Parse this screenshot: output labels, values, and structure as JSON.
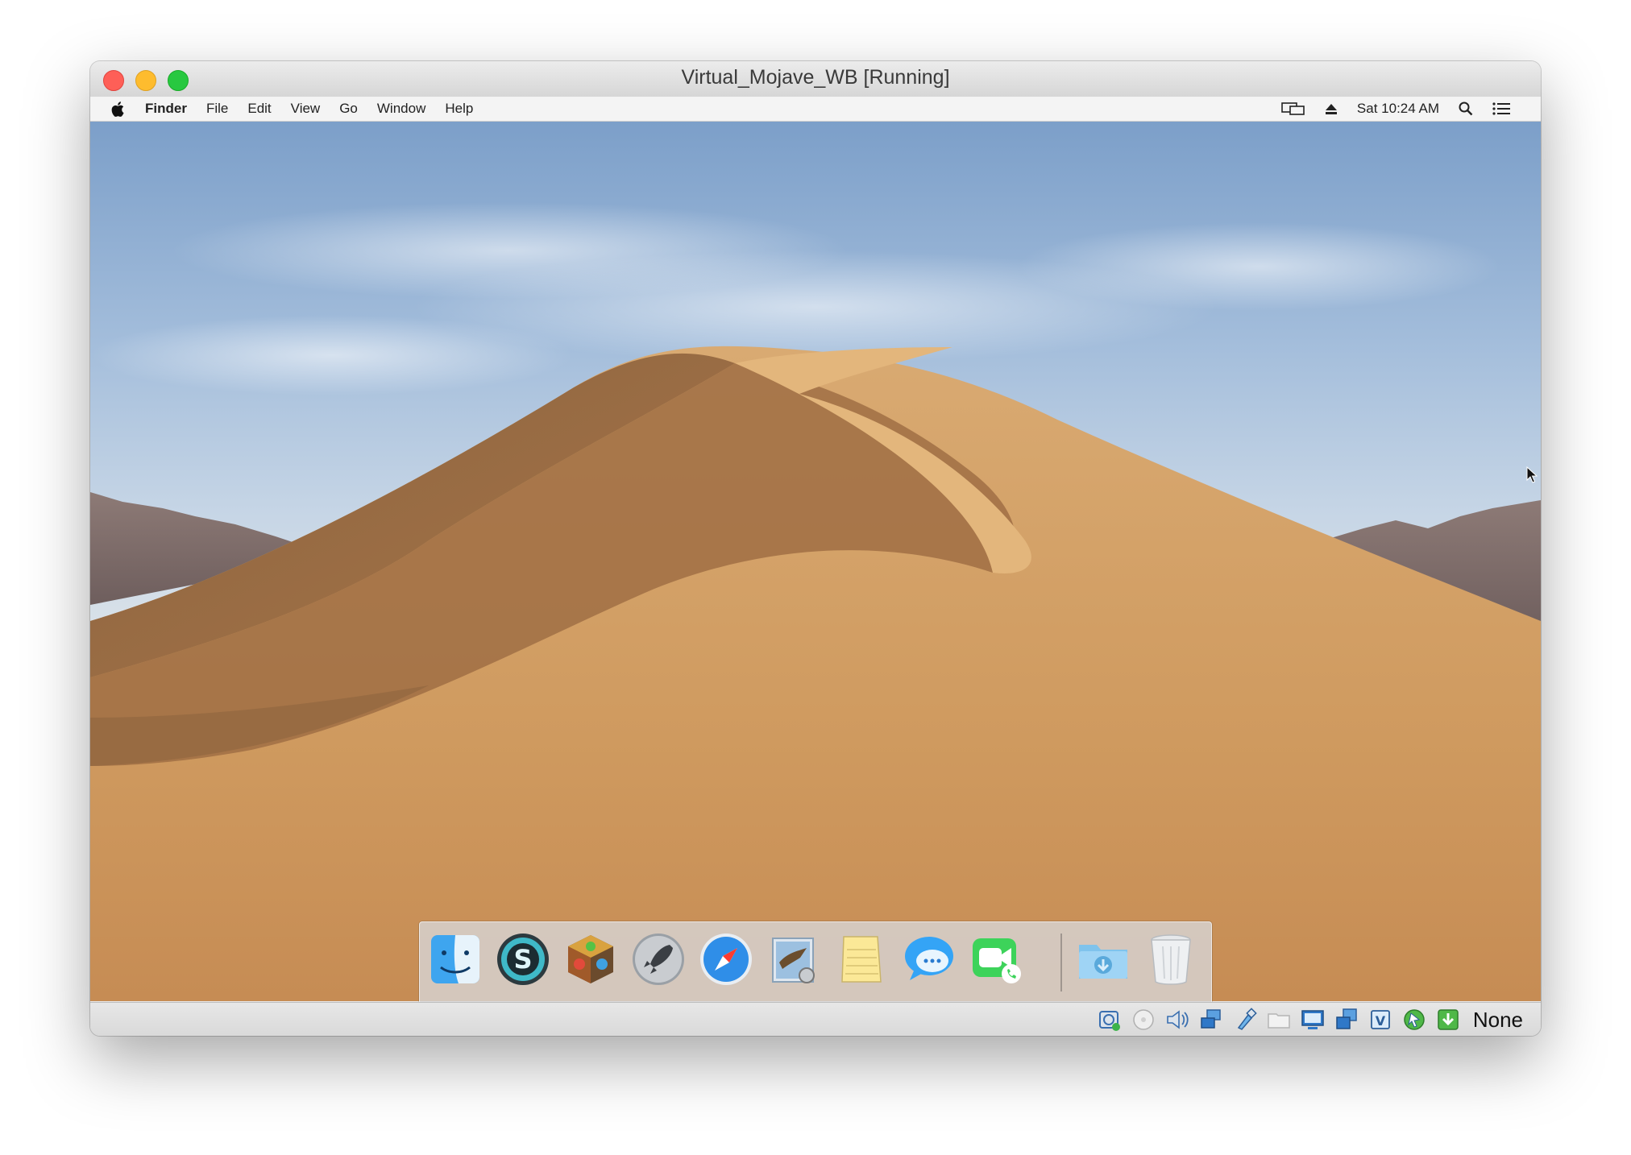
{
  "window": {
    "title": "Virtual_Mojave_WB [Running]"
  },
  "menubar": {
    "app_name": "Finder",
    "items": [
      "File",
      "Edit",
      "View",
      "Go",
      "Window",
      "Help"
    ],
    "clock": "Sat 10:24 AM",
    "right_icons": [
      "display-mirroring-icon",
      "eject-icon",
      "spotlight-search-icon",
      "notification-center-icon"
    ]
  },
  "dock": {
    "apps": [
      {
        "name": "Finder",
        "icon": "finder-icon",
        "running": true
      },
      {
        "name": "Skype",
        "icon": "skype-icon",
        "running": false
      },
      {
        "name": "Cube app",
        "icon": "cube-app-icon",
        "running": false
      },
      {
        "name": "Launchpad",
        "icon": "launchpad-rocket-icon",
        "running": false
      },
      {
        "name": "Safari",
        "icon": "safari-compass-icon",
        "running": false
      },
      {
        "name": "Mail",
        "icon": "mail-eagle-icon",
        "running": false
      },
      {
        "name": "Notes",
        "icon": "notes-icon",
        "running": false
      },
      {
        "name": "Messages",
        "icon": "messages-icon",
        "running": false
      },
      {
        "name": "FaceTime",
        "icon": "facetime-icon",
        "running": false
      }
    ],
    "stacks": [
      {
        "name": "Downloads",
        "icon": "downloads-folder-icon"
      },
      {
        "name": "Trash",
        "icon": "trash-icon"
      }
    ]
  },
  "statusbar": {
    "icons": [
      "hard-disk-icon",
      "optical-disc-icon",
      "audio-icon",
      "network-icon",
      "usb-icon",
      "shared-folder-icon",
      "display-icon",
      "video-capture-icon",
      "cpu-icon",
      "mouse-integration-icon",
      "host-key-download-icon"
    ],
    "host_key_label": "None"
  },
  "colors": {
    "close": "#fe5f57",
    "minimize": "#febc2e",
    "maximize": "#28c840",
    "sand": "#c9955a"
  }
}
